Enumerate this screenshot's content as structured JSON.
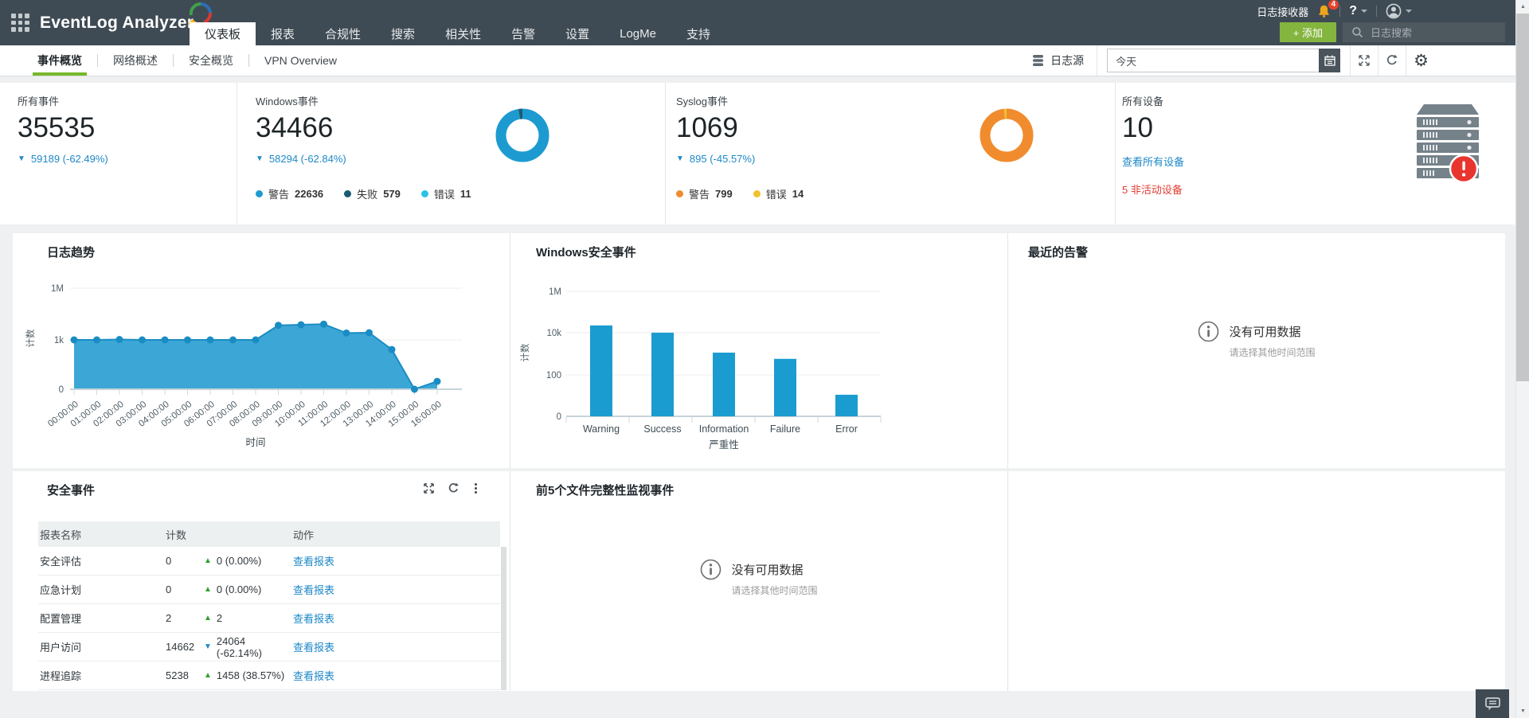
{
  "icons": {
    "up": "▲",
    "down": "▼",
    "gear": "⚙"
  },
  "header": {
    "logo_text": "EventLog Analyzer",
    "tabs": [
      {
        "label": "仪表板",
        "active": true
      },
      {
        "label": "报表"
      },
      {
        "label": "合规性"
      },
      {
        "label": "搜索"
      },
      {
        "label": "相关性"
      },
      {
        "label": "告警"
      },
      {
        "label": "设置"
      },
      {
        "label": "LogMe"
      },
      {
        "label": "支持"
      }
    ],
    "log_receiver": "日志接收器",
    "notification_badge": "4",
    "help": "?",
    "add_button": "+ 添加",
    "search_placeholder": "日志搜索"
  },
  "subnav": {
    "tabs": [
      {
        "label": "事件概览",
        "active": true
      },
      {
        "label": "网络概述"
      },
      {
        "label": "安全概览"
      },
      {
        "label": "VPN Overview"
      }
    ],
    "log_source": "日志源",
    "date_range": "今天"
  },
  "stats": {
    "all_events": {
      "label": "所有事件",
      "value": "35535",
      "change": "59189 (-62.49%)",
      "direction": "down"
    },
    "windows_events": {
      "label": "Windows事件",
      "value": "34466",
      "change": "58294 (-62.84%)",
      "direction": "down",
      "legend": [
        {
          "label": "警告",
          "value": "22636",
          "color": "#1d9bd1"
        },
        {
          "label": "失败",
          "value": "579",
          "color": "#1b5a74"
        },
        {
          "label": "错误",
          "value": "11",
          "color": "#29c2e6"
        }
      ]
    },
    "syslog_events": {
      "label": "Syslog事件",
      "value": "1069",
      "change": "895 (-45.57%)",
      "direction": "down",
      "legend": [
        {
          "label": "警告",
          "value": "799",
          "color": "#f08c2e"
        },
        {
          "label": "错误",
          "value": "14",
          "color": "#f0c12e"
        }
      ]
    },
    "all_devices": {
      "label": "所有设备",
      "value": "10",
      "link": "查看所有设备",
      "inactive_note": "5 非活动设备"
    }
  },
  "panels": {
    "log_trend": {
      "title": "日志趋势"
    },
    "windows_security": {
      "title": "Windows安全事件"
    },
    "recent_alerts": {
      "title": "最近的告警",
      "no_data": "没有可用数据",
      "no_data_hint": "请选择其他时间范围"
    },
    "security_events": {
      "title": "安全事件",
      "table": {
        "headers": [
          "报表名称",
          "计数",
          "动作"
        ],
        "rows": [
          {
            "name": "安全评估",
            "count": "0",
            "change": "0 (0.00%)",
            "direction": "up",
            "action": "查看报表"
          },
          {
            "name": "应急计划",
            "count": "0",
            "change": "0 (0.00%)",
            "direction": "up",
            "action": "查看报表"
          },
          {
            "name": "配置管理",
            "count": "2",
            "change": "2",
            "direction": "up",
            "action": "查看报表"
          },
          {
            "name": "用户访问",
            "count": "14662",
            "change": "24064 (-62.14%)",
            "direction": "down",
            "action": "查看报表"
          },
          {
            "name": "进程追踪",
            "count": "5238",
            "change": "1458 (38.57%)",
            "direction": "up",
            "action": "查看报表"
          }
        ]
      }
    },
    "fim": {
      "title": "前5个文件完整性监视事件",
      "no_data": "没有可用数据",
      "no_data_hint": "请选择其他时间范围"
    }
  },
  "chart_data": [
    {
      "type": "area",
      "title": "日志趋势",
      "x": [
        "00:00:00",
        "01:00:00",
        "02:00:00",
        "03:00:00",
        "04:00:00",
        "05:00:00",
        "06:00:00",
        "07:00:00",
        "08:00:00",
        "09:00:00",
        "10:00:00",
        "11:00:00",
        "12:00:00",
        "13:00:00",
        "14:00:00",
        "15:00:00",
        "16:00:00"
      ],
      "values": [
        1000,
        1000,
        1050,
        1000,
        1000,
        1000,
        1000,
        1000,
        1000,
        7000,
        7500,
        8200,
        2500,
        2600,
        260,
        0,
        3
      ],
      "xlabel": "时间",
      "ylabel": "计数",
      "yscale": "log",
      "yticks": [
        "0",
        "1k",
        "1M"
      ],
      "ylim": [
        0,
        1000000
      ],
      "color": "#2b9fd3",
      "line_color": "#1a8cc4"
    },
    {
      "type": "bar",
      "title": "Windows安全事件",
      "categories": [
        "Warning",
        "Success",
        "Information",
        "Failure",
        "Error"
      ],
      "values": [
        22636,
        10100,
        1140,
        579,
        11
      ],
      "xlabel": "严重性",
      "ylabel": "计数",
      "yscale": "log",
      "yticks": [
        "0",
        "100",
        "10k",
        "1M"
      ],
      "ylim": [
        0,
        1000000
      ],
      "color": "#1b9cd0"
    },
    {
      "type": "donut",
      "name": "windows-events-by-severity",
      "slices": [
        {
          "label": "警告",
          "value": 22636,
          "color": "#1d9bd1"
        },
        {
          "label": "失败",
          "value": 579,
          "color": "#1b5a74"
        },
        {
          "label": "错误",
          "value": 11,
          "color": "#29c2e6"
        }
      ]
    },
    {
      "type": "donut",
      "name": "syslog-events-by-severity",
      "slices": [
        {
          "label": "警告",
          "value": 799,
          "color": "#f08c2e"
        },
        {
          "label": "错误",
          "value": 14,
          "color": "#f0c12e"
        }
      ]
    }
  ]
}
